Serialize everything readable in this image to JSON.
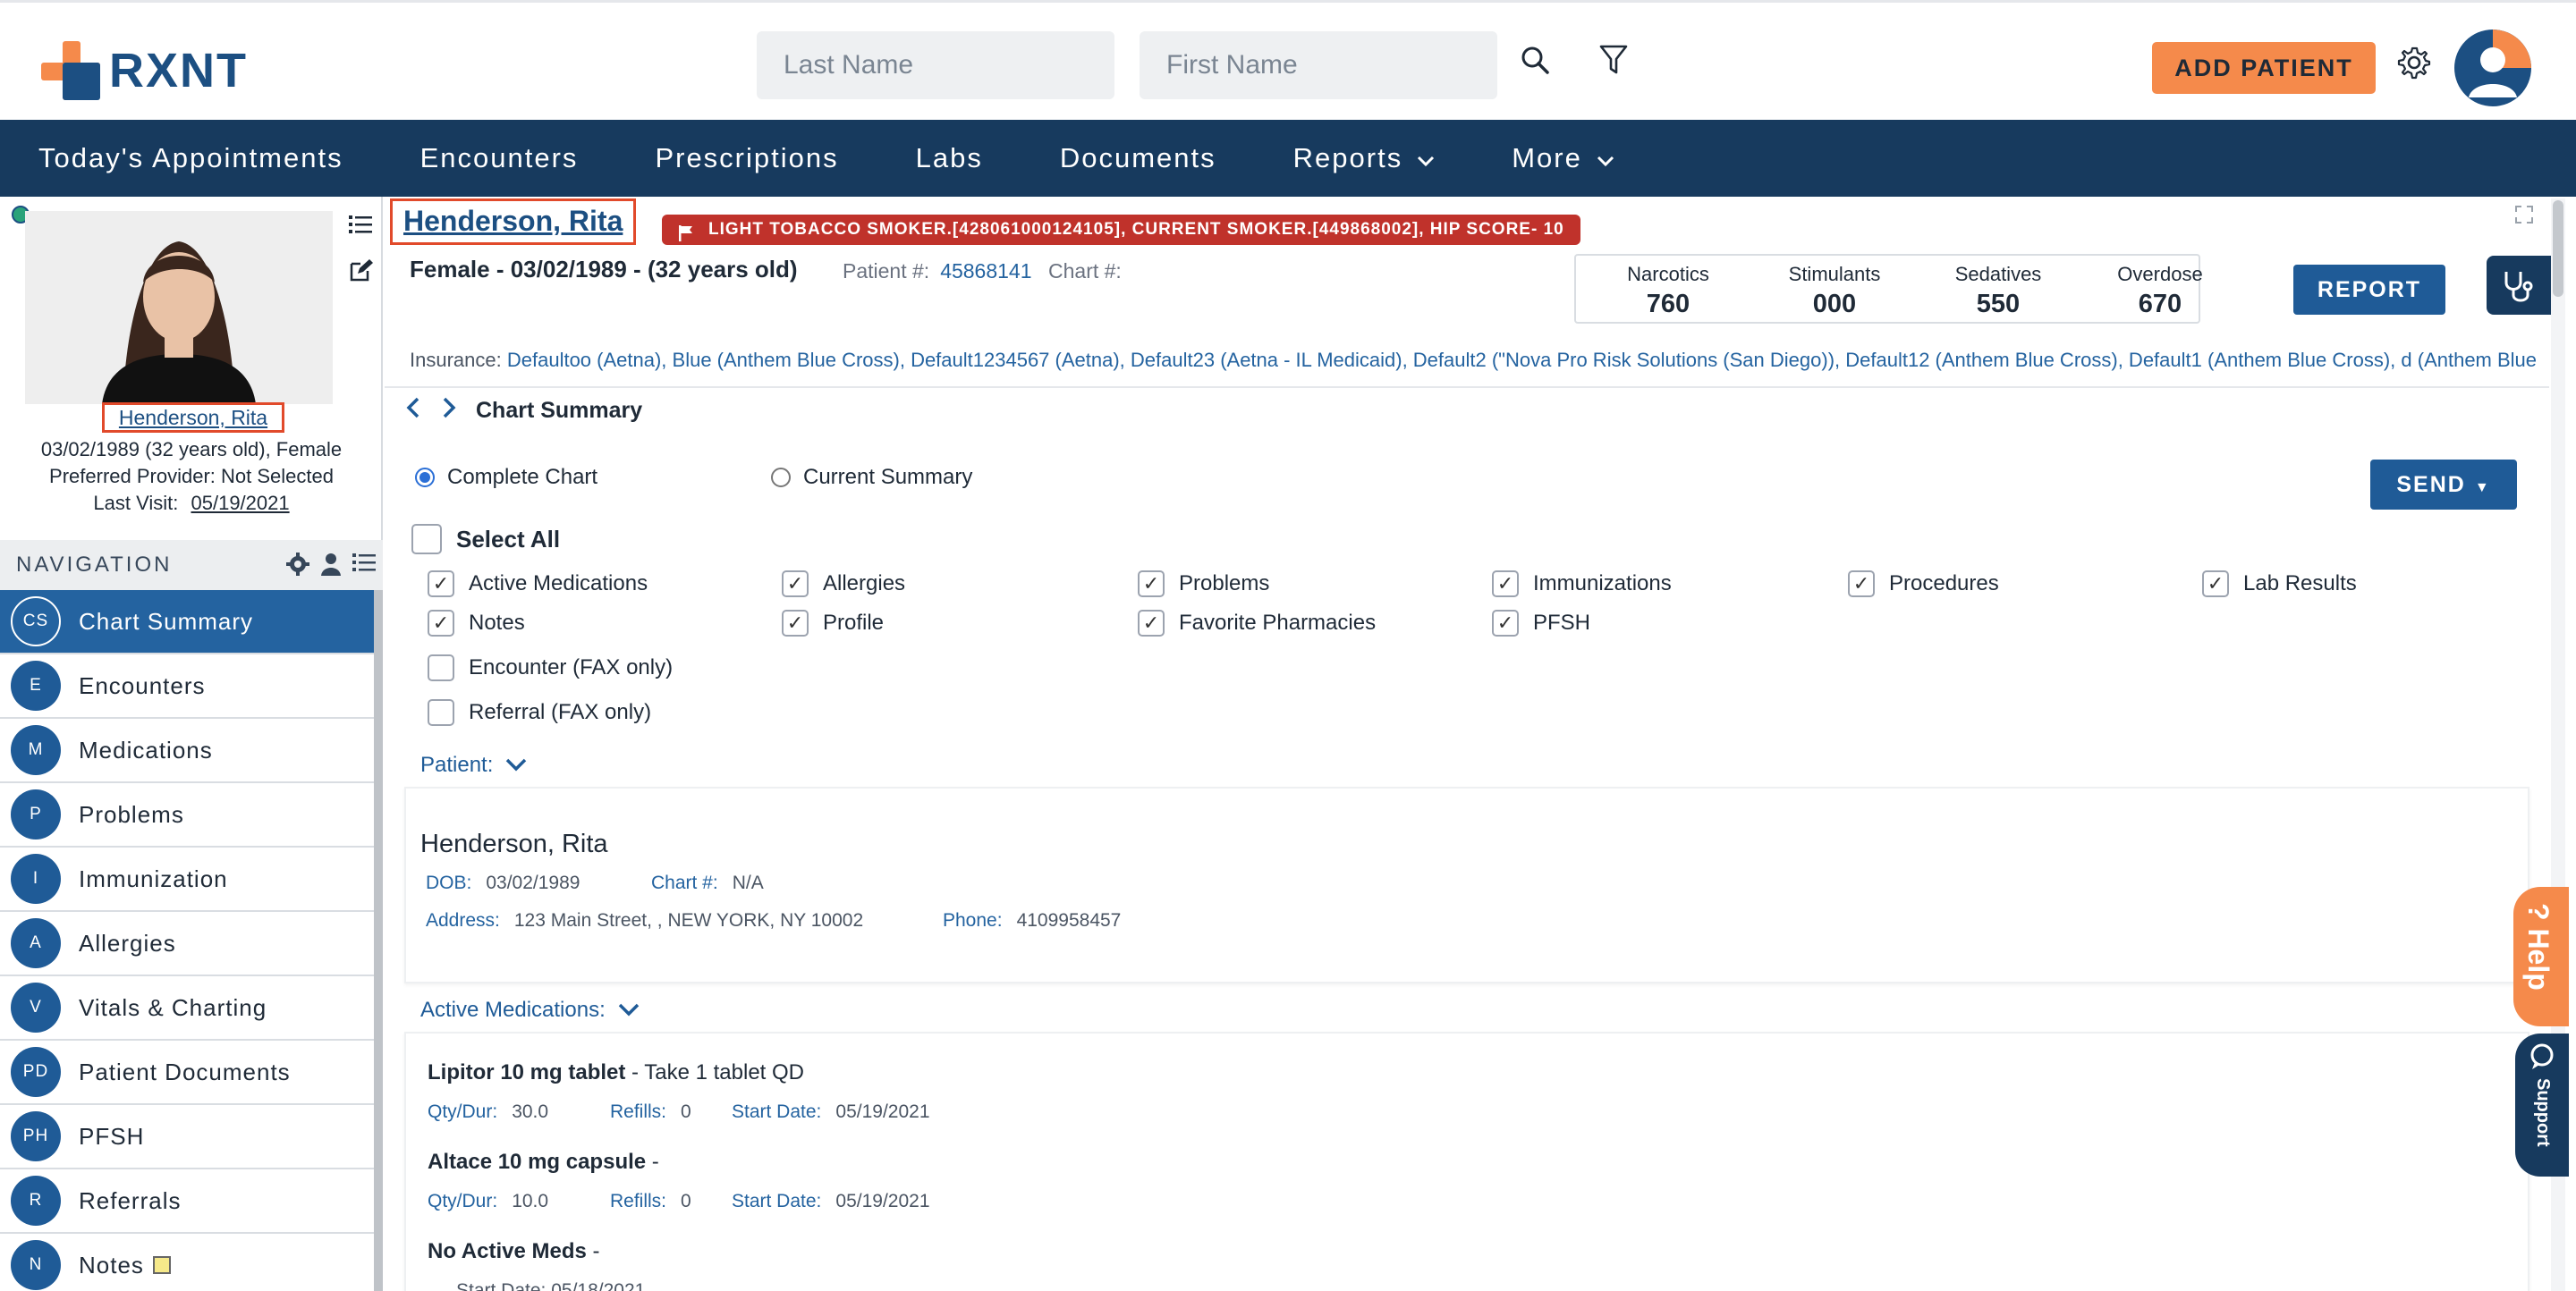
{
  "header": {
    "logo_text": "RXNT",
    "last_name_placeholder": "Last Name",
    "first_name_placeholder": "First Name",
    "add_patient_label": "ADD PATIENT"
  },
  "nav": {
    "items": [
      "Today's Appointments",
      "Encounters",
      "Prescriptions",
      "Labs",
      "Documents",
      "Reports",
      "More"
    ]
  },
  "sidebar": {
    "patient_name": "Henderson, Rita",
    "dob_line": "03/02/1989 (32 years old), Female",
    "provider_line": "Preferred Provider: Not Selected",
    "last_visit_label": "Last Visit:",
    "last_visit_value": "05/19/2021",
    "navigation_title": "NAVIGATION",
    "items": [
      {
        "badge": "CS",
        "label": "Chart Summary"
      },
      {
        "badge": "E",
        "label": "Encounters"
      },
      {
        "badge": "M",
        "label": "Medications"
      },
      {
        "badge": "P",
        "label": "Problems"
      },
      {
        "badge": "I",
        "label": "Immunization"
      },
      {
        "badge": "A",
        "label": "Allergies"
      },
      {
        "badge": "V",
        "label": "Vitals & Charting"
      },
      {
        "badge": "PD",
        "label": "Patient Documents"
      },
      {
        "badge": "PH",
        "label": "PFSH"
      },
      {
        "badge": "R",
        "label": "Referrals"
      },
      {
        "badge": "N",
        "label": "Notes"
      }
    ]
  },
  "patient_header": {
    "name": "Henderson, Rita",
    "alert": "LIGHT TOBACCO SMOKER.[428061000124105], CURRENT SMOKER.[449868002], HIP SCORE- 10",
    "demographics": "Female - 03/02/1989 - (32 years old)",
    "patient_num_label": "Patient #:",
    "patient_num": "45868141",
    "chart_num_label": "Chart #:",
    "insurance_label": "Insurance:",
    "insurance_value": "Defaultoo (Aetna), Blue (Anthem Blue Cross), Default1234567 (Aetna), Default23 (Aetna - IL Medicaid), Default2 (\"Nova Pro Risk Solutions (San Diego)), Default12 (Anthem Blue Cross), Default1 (Anthem Blue Cross), d (Anthem Blue"
  },
  "pdmp": {
    "narcotics_label": "Narcotics",
    "narcotics": "760",
    "stimulants_label": "Stimulants",
    "stimulants": "000",
    "sedatives_label": "Sedatives",
    "sedatives": "550",
    "overdose_label": "Overdose",
    "overdose": "670",
    "report_label": "REPORT"
  },
  "summary": {
    "breadcrumb": "Chart Summary",
    "complete_chart": "Complete Chart",
    "current_summary": "Current Summary",
    "send_label": "SEND",
    "select_all": "Select All",
    "options": {
      "active_medications": "Active Medications",
      "allergies": "Allergies",
      "problems": "Problems",
      "immunizations": "Immunizations",
      "procedures": "Procedures",
      "lab_results": "Lab Results",
      "notes": "Notes",
      "profile": "Profile",
      "favorite_pharmacies": "Favorite Pharmacies",
      "pfsh": "PFSH",
      "encounter_fax": "Encounter (FAX only)",
      "referral_fax": "Referral (FAX only)"
    }
  },
  "patient_section": {
    "heading": "Patient:",
    "name": "Henderson, Rita",
    "dob_label": "DOB:",
    "dob": "03/02/1989",
    "chart_label": "Chart #:",
    "chart": "N/A",
    "address_label": "Address:",
    "address": "123 Main Street, , NEW YORK, NY 10002",
    "phone_label": "Phone:",
    "phone": "4109958457"
  },
  "medications_section": {
    "heading": "Active Medications:",
    "meds": [
      {
        "name": "Lipitor 10 mg tablet",
        "sig": " - Take 1 tablet QD",
        "qty_label": "Qty/Dur:",
        "qty": "30.0",
        "refills_label": "Refills:",
        "refills": "0",
        "start_label": "Start Date:",
        "start": "05/19/2021"
      },
      {
        "name": "Altace 10 mg capsule",
        "sig": " -",
        "qty_label": "Qty/Dur:",
        "qty": "10.0",
        "refills_label": "Refills:",
        "refills": "0",
        "start_label": "Start Date:",
        "start": "05/19/2021"
      }
    ],
    "no_active_meds": "No Active Meds",
    "no_active_suffix": " -",
    "partial_start": "Start Date: 05/18/2021"
  },
  "tabs": {
    "help": "Help",
    "support": "Support"
  }
}
